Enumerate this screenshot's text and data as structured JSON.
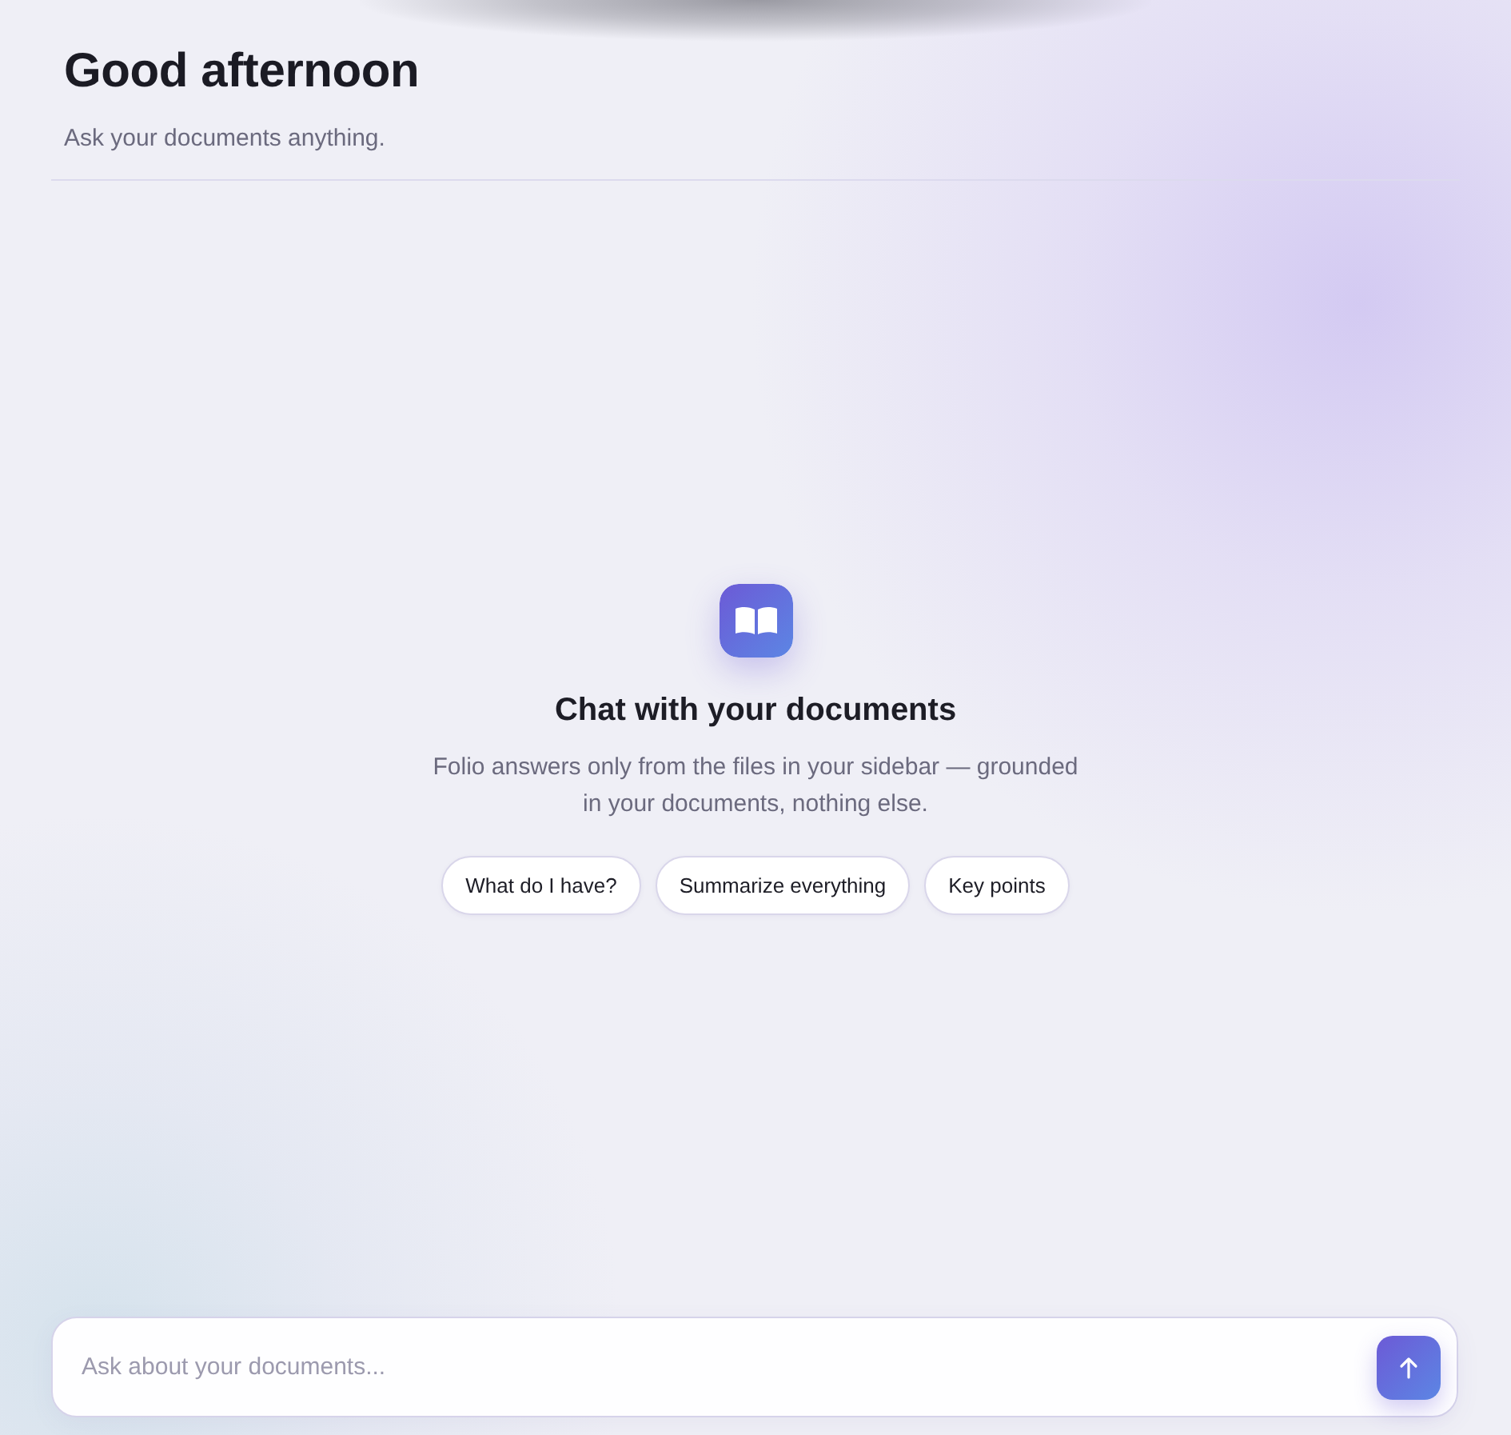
{
  "header": {
    "title": "Good afternoon",
    "subtitle": "Ask your documents anything."
  },
  "empty_state": {
    "title": "Chat with your documents",
    "description": "Folio answers only from the files in your sidebar — grounded in your documents, nothing else.",
    "suggestions": [
      "What do I have?",
      "Summarize everything",
      "Key points"
    ]
  },
  "composer": {
    "placeholder": "Ask about your documents..."
  }
}
